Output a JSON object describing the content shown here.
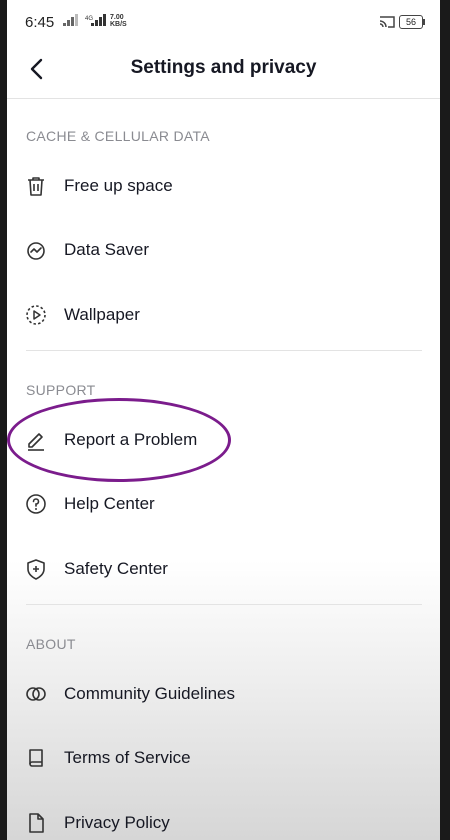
{
  "status": {
    "time": "6:45",
    "net_speed_value": "7.00",
    "net_speed_unit": "KB/S",
    "network_type": "4G",
    "battery": "56"
  },
  "header": {
    "title": "Settings and privacy"
  },
  "sections": {
    "cache": {
      "title": "CACHE & CELLULAR DATA",
      "items": [
        "Free up space",
        "Data Saver",
        "Wallpaper"
      ]
    },
    "support": {
      "title": "SUPPORT",
      "items": [
        "Report a Problem",
        "Help Center",
        "Safety Center"
      ]
    },
    "about": {
      "title": "ABOUT",
      "items": [
        "Community Guidelines",
        "Terms of Service",
        "Privacy Policy"
      ]
    }
  },
  "annotation": {
    "color": "#7b1c8c",
    "highlighted_item": "Report a Problem"
  },
  "icons": {
    "free_up_space": "trash-icon",
    "data_saver": "data-saver-icon",
    "wallpaper": "wallpaper-icon",
    "report_problem": "pencil-icon",
    "help_center": "help-icon",
    "safety_center": "shield-icon",
    "community_guidelines": "rings-icon",
    "terms_of_service": "book-icon",
    "privacy_policy": "document-icon"
  }
}
